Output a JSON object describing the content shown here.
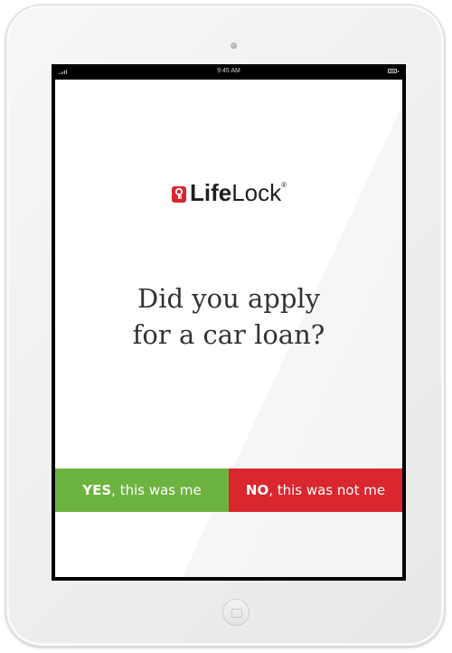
{
  "status_bar": {
    "time": "9:45 AM"
  },
  "logo": {
    "bold": "Life",
    "light": "Lock",
    "mark": "®",
    "icon": "lock-icon",
    "brand_color": "#d9262f"
  },
  "question": {
    "line1": "Did you apply",
    "line2": "for a car loan?"
  },
  "answers": {
    "yes": {
      "strong": "YES",
      "rest": ", this was me",
      "color": "#6db33f"
    },
    "no": {
      "strong": "NO",
      "rest": ", this was not me",
      "color": "#d9262f"
    }
  }
}
